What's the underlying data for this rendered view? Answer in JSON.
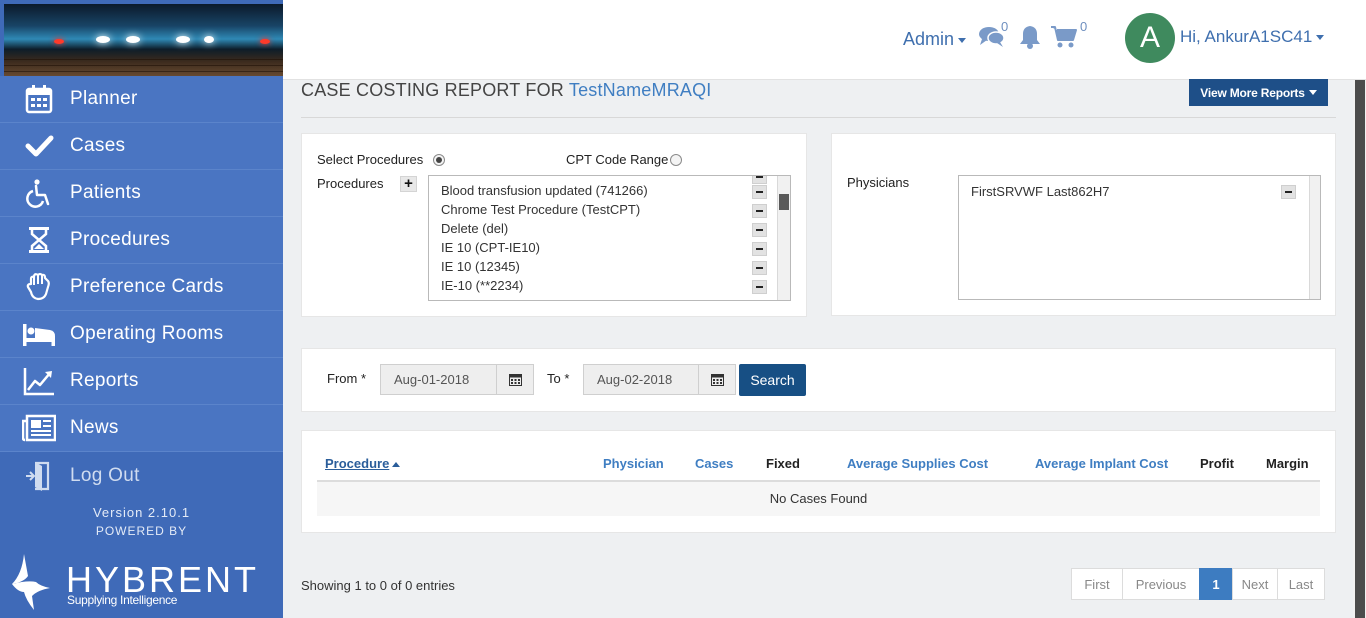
{
  "sidebar": {
    "items": [
      {
        "label": "Planner",
        "icon": "calendar-icon"
      },
      {
        "label": "Cases",
        "icon": "checkmark-icon"
      },
      {
        "label": "Patients",
        "icon": "wheelchair-icon"
      },
      {
        "label": "Procedures",
        "icon": "hourglass-icon"
      },
      {
        "label": "Preference Cards",
        "icon": "glove-icon"
      },
      {
        "label": "Operating Rooms",
        "icon": "bed-icon"
      },
      {
        "label": "Reports",
        "icon": "line-chart-icon"
      },
      {
        "label": "News",
        "icon": "newspaper-icon"
      },
      {
        "label": "Log Out",
        "icon": "logout-door-icon"
      }
    ],
    "version": "Version 2.10.1",
    "powered_by": "POWERED BY",
    "brand_name": "HYBRENT",
    "brand_tagline": "Supplying Intelligence"
  },
  "header": {
    "admin_label": "Admin",
    "messages_count": "0",
    "cart_count": "0",
    "avatar_letter": "A",
    "greeting": "Hi, AnkurA1SC41"
  },
  "report": {
    "title_prefix": "CASE COSTING REPORT FOR",
    "title_name": "TestNameMRAQI",
    "view_more_label": "View More Reports"
  },
  "filters": {
    "select_procedures_label": "Select Procedures",
    "cpt_code_range_label": "CPT Code Range",
    "procedures_label": "Procedures",
    "procedures": [
      "Blood transfusion updated (741266)",
      "Chrome Test Procedure (TestCPT)",
      "Delete (del)",
      "IE 10 (CPT-IE10)",
      "IE 10 (12345)",
      "IE-10 (**2234)"
    ],
    "physicians_label": "Physicians",
    "physicians": [
      "FirstSRVWF Last862H7"
    ],
    "from_label": "From *",
    "from_value": "Aug-01-2018",
    "to_label": "To *",
    "to_value": "Aug-02-2018",
    "search_label": "Search"
  },
  "table": {
    "columns": [
      "Procedure",
      "Physician",
      "Cases",
      "Fixed",
      "Average Supplies Cost",
      "Average Implant Cost",
      "Profit",
      "Margin"
    ],
    "empty_message": "No Cases Found"
  },
  "pagination": {
    "showing": "Showing 1 to 0 of 0 entries",
    "first": "First",
    "previous": "Previous",
    "current": "1",
    "next": "Next",
    "last": "Last"
  },
  "colors": {
    "sidebar_bg": "#3f6ab8",
    "accent": "#1e4f88",
    "link": "#3f7ec2",
    "avatar": "#3f8a5e"
  }
}
